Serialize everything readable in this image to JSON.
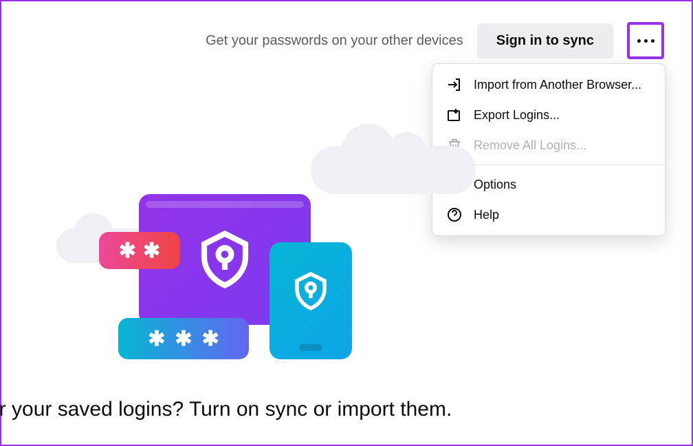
{
  "header": {
    "prompt": "Get your passwords on your other devices",
    "sign_in_label": "Sign in to sync"
  },
  "menu": {
    "import_label": "Import from Another Browser...",
    "export_label": "Export Logins...",
    "remove_label": "Remove All Logins...",
    "options_label": "Options",
    "help_label": "Help"
  },
  "footer": {
    "text": "or your saved logins? Turn on sync or import them."
  }
}
